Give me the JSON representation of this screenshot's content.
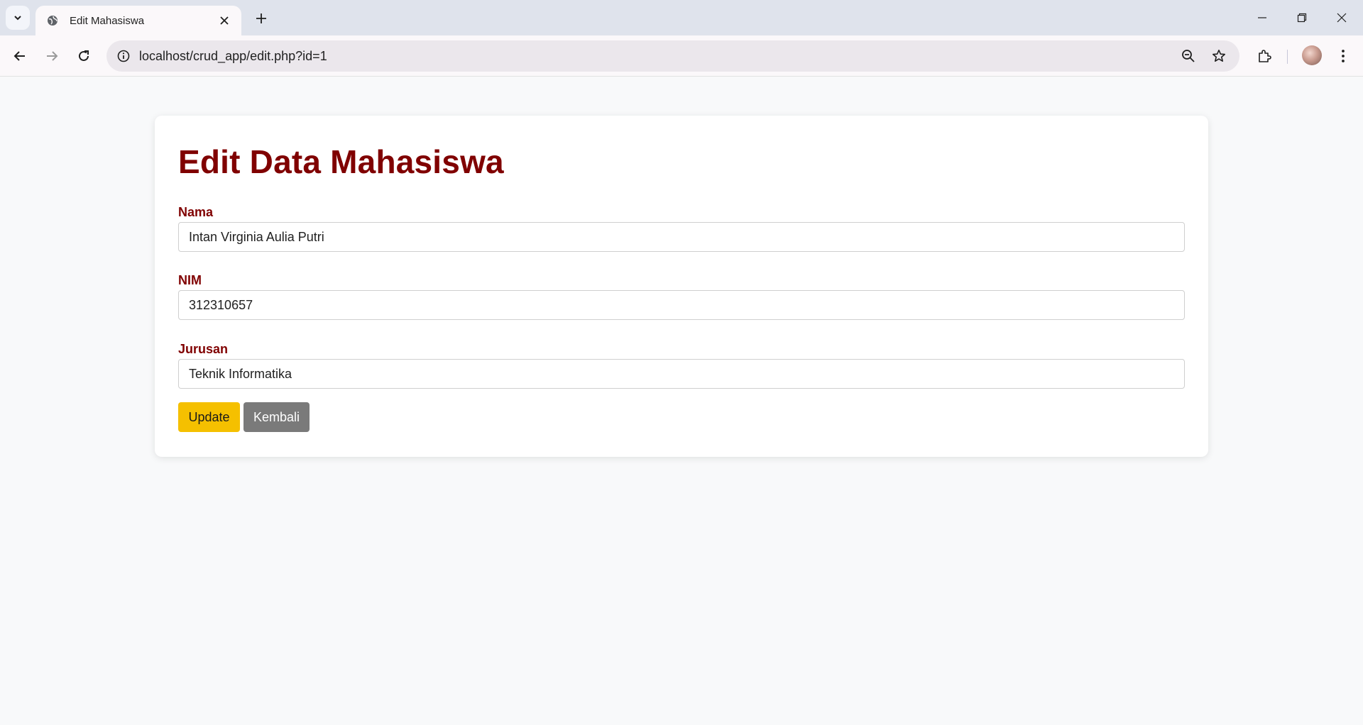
{
  "browser": {
    "tab_title": "Edit Mahasiswa",
    "url": "localhost/crud_app/edit.php?id=1",
    "icons": [
      "tab-search-icon",
      "globe-icon",
      "close-icon",
      "plus-icon",
      "minimize-icon",
      "restore-icon",
      "window-close-icon",
      "back-arrow-icon",
      "forward-arrow-icon",
      "reload-icon",
      "info-icon",
      "zoom-icon",
      "star-icon",
      "extensions-icon",
      "avatar",
      "kebab-menu-icon"
    ]
  },
  "form": {
    "title": "Edit Data Mahasiswa",
    "fields": [
      {
        "label": "Nama",
        "value": "Intan Virginia Aulia Putri"
      },
      {
        "label": "NIM",
        "value": "312310657"
      },
      {
        "label": "Jurusan",
        "value": "Teknik Informatika"
      }
    ],
    "update_label": "Update",
    "back_label": "Kembali"
  },
  "colors": {
    "heading": "#800000",
    "update_button": "#f5c000",
    "back_button": "#7a7a7a",
    "page_background": "#f8f9fa"
  }
}
